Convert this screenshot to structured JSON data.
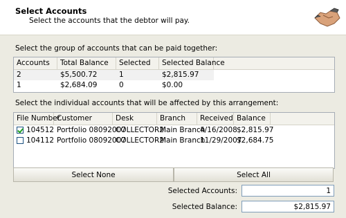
{
  "header": {
    "title": "Select Accounts",
    "subtitle": "Select the accounts that the debtor will pay."
  },
  "groups": {
    "prompt": "Select the group of accounts that can be paid together:",
    "columns": [
      "Accounts",
      "Total Balance",
      "Selected",
      "Selected Balance"
    ],
    "rows": [
      [
        "2",
        "$5,500.72",
        "1",
        "$2,815.97"
      ],
      [
        "1",
        "$2,684.09",
        "0",
        "$0.00"
      ]
    ]
  },
  "accounts": {
    "prompt": "Select the individual accounts that will be affected by this arrangement:",
    "columns": [
      "File Number",
      "Customer",
      "Desk",
      "Branch",
      "Received",
      "Balance"
    ],
    "rows": [
      {
        "checked": true,
        "cells": [
          "104512",
          "Portfolio 08092007",
          "COLLECTOR2",
          "Main Branch",
          "4/16/2008",
          "$2,815.97"
        ]
      },
      {
        "checked": false,
        "cells": [
          "104112",
          "Portfolio 08092007",
          "COLLECTOR2",
          "Main Branch",
          "11/29/2007",
          "$2,684.75"
        ]
      }
    ]
  },
  "buttons": {
    "select_none": "Select None",
    "select_all": "Select All"
  },
  "summary": {
    "selected_accounts_label": "Selected Accounts:",
    "selected_accounts_value": "1",
    "selected_balance_label": "Selected Balance:",
    "selected_balance_value": "$2,815.97"
  }
}
